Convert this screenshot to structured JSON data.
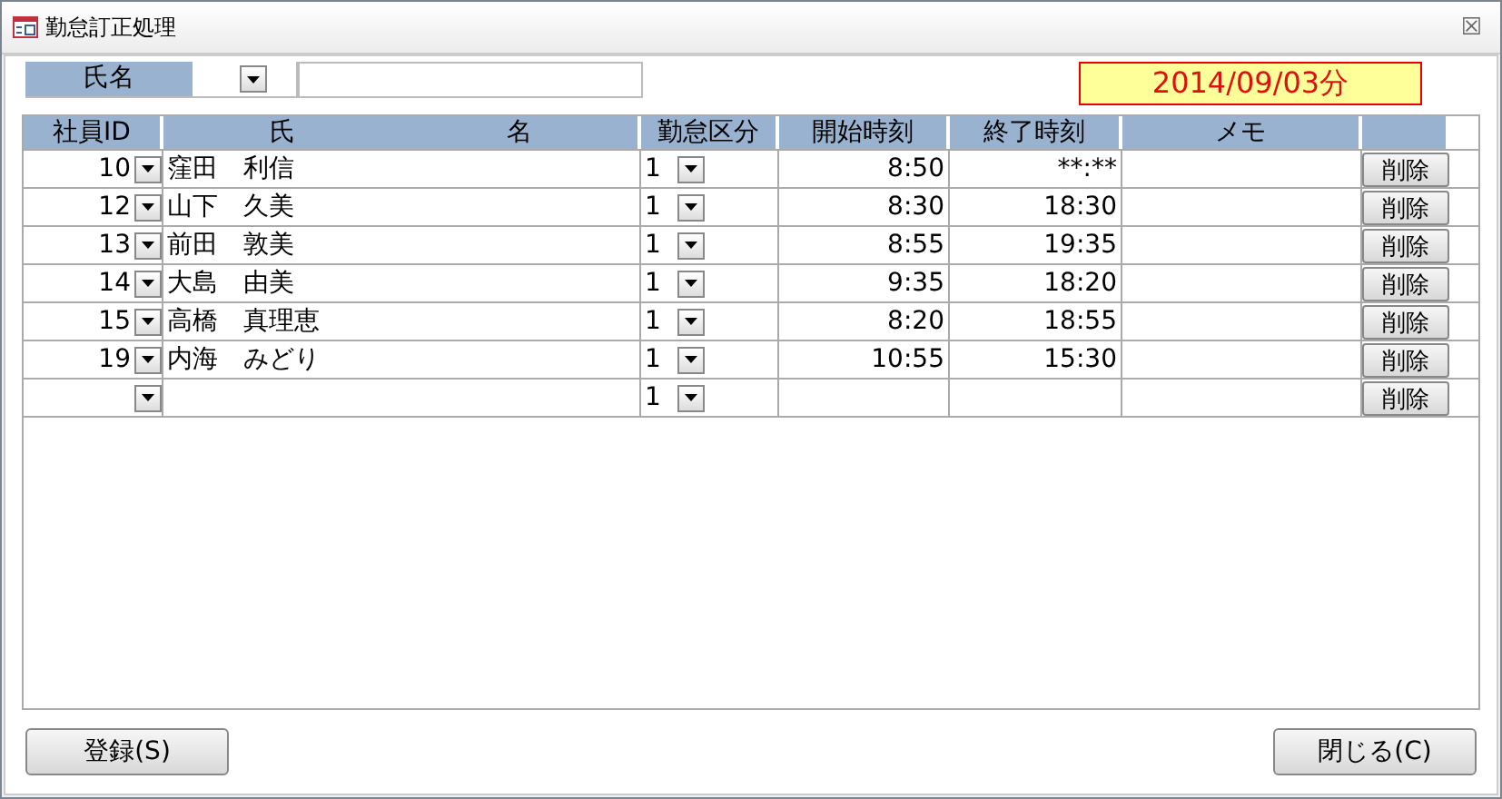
{
  "window": {
    "title": "勤怠訂正処理",
    "close": "☒"
  },
  "filter": {
    "label": "氏名"
  },
  "date": "2014/09/03分",
  "table": {
    "columns": [
      {
        "kind": "text",
        "label": "社員ID"
      },
      {
        "kind": "split",
        "parts": [
          "氏",
          "名"
        ]
      },
      {
        "kind": "text",
        "label": "勤怠区分"
      },
      {
        "kind": "text",
        "label": "開始時刻"
      },
      {
        "kind": "text",
        "label": "終了時刻"
      },
      {
        "kind": "text",
        "label": "メモ"
      }
    ],
    "rows": [
      {
        "id": "10",
        "name": "窪田　利信",
        "kubun": "1",
        "start": "8:50",
        "end": "**:**",
        "delete": "削除"
      },
      {
        "id": "12",
        "name": "山下　久美",
        "kubun": "1",
        "start": "8:30",
        "end": "18:30",
        "delete": "削除"
      },
      {
        "id": "13",
        "name": "前田　敦美",
        "kubun": "1",
        "start": "8:55",
        "end": "19:35",
        "delete": "削除"
      },
      {
        "id": "14",
        "name": "大島　由美",
        "kubun": "1",
        "start": "9:35",
        "end": "18:20",
        "delete": "削除"
      },
      {
        "id": "15",
        "name": "高橋　真理恵",
        "kubun": "1",
        "start": "8:20",
        "end": "18:55",
        "delete": "削除"
      },
      {
        "id": "19",
        "name": "内海　みどり",
        "kubun": "1",
        "start": "10:55",
        "end": "15:30",
        "delete": "削除"
      },
      {
        "kubun": "1",
        "delete": "削除"
      }
    ]
  },
  "buttons": [
    "登録(S)",
    "閉じる(C)"
  ]
}
